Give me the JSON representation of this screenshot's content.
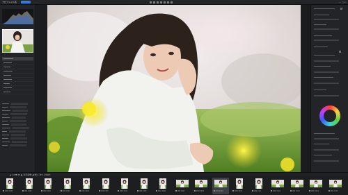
{
  "top_bar": {
    "app_name": "プロファイル名",
    "tab_label": "現像",
    "right_text": "—  □  ×"
  },
  "filmstrip": {
    "folder_label": "▲ 13 ▼ 35 ▶ 表示画像 ◀ 前へ 次へ の中の",
    "thumbnails": [
      {
        "name": "2MZ 2398",
        "kind": "portrait"
      },
      {
        "name": "2MZ 2399",
        "kind": "portrait"
      },
      {
        "name": "2MZ 2400",
        "kind": "portrait"
      },
      {
        "name": "2MZ 2401",
        "kind": "portrait"
      },
      {
        "name": "2MZ 2402",
        "kind": "portrait"
      },
      {
        "name": "2MZ 2403",
        "kind": "portrait"
      },
      {
        "name": "2MZ 2404",
        "kind": "portrait"
      },
      {
        "name": "2MZ 2405",
        "kind": "portrait"
      },
      {
        "name": "2MZ 2406",
        "kind": "portrait"
      },
      {
        "name": "2MZ 2407",
        "kind": "landscape"
      },
      {
        "name": "2MZ 2408",
        "kind": "landscape"
      },
      {
        "name": "2MZ 2409",
        "kind": "landscape",
        "selected": true
      },
      {
        "name": "2MZ 2410",
        "kind": "portrait"
      },
      {
        "name": "2MZ 2411",
        "kind": "portrait"
      },
      {
        "name": "2MZ 2412",
        "kind": "landscape"
      },
      {
        "name": "2MZ 2413",
        "kind": "landscape"
      },
      {
        "name": "2MZ 2414",
        "kind": "landscape"
      },
      {
        "name": "2MZ 2415",
        "kind": "landscape"
      }
    ]
  },
  "colors": {
    "accent": "#2f7ee0",
    "panel_bg": "#232427",
    "workspace_bg": "#1b1c1e"
  }
}
